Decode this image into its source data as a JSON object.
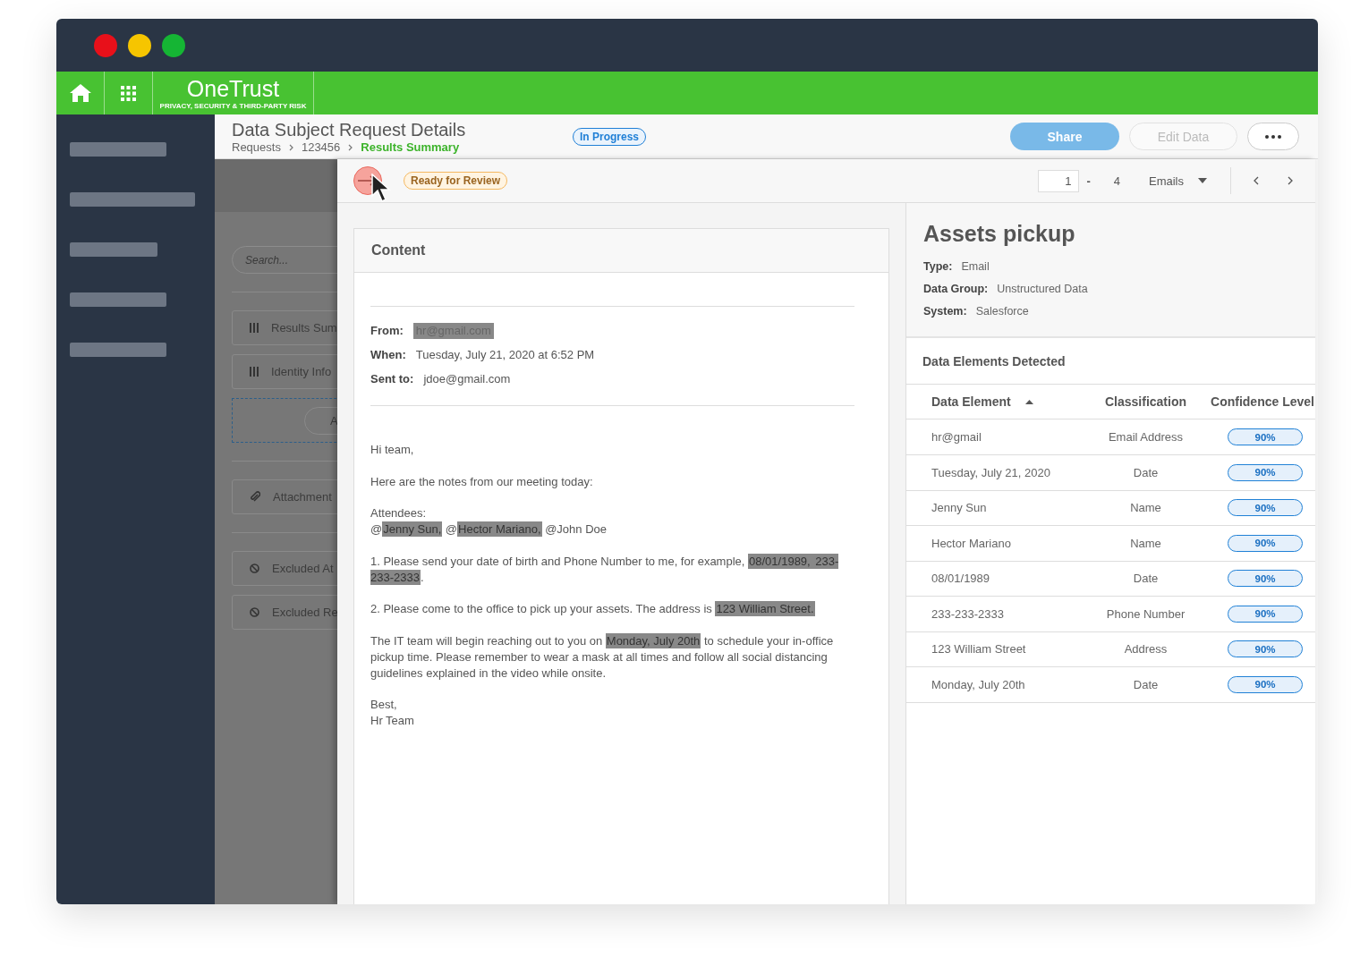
{
  "window": {
    "controls": [
      {
        "color": "#e8101a"
      },
      {
        "color": "#f6c500"
      },
      {
        "color": "#15b534"
      }
    ]
  },
  "nav": {
    "logo": "OneTrust",
    "tagline": "PRIVACY, SECURITY & THIRD-PARTY RISK"
  },
  "header": {
    "title": "Data Subject Request Details",
    "breadcrumbs": [
      {
        "label": "Requests",
        "current": false
      },
      {
        "label": "123456",
        "current": false
      },
      {
        "label": "Results Summary",
        "current": true
      }
    ],
    "status": "In Progress",
    "buttons": [
      {
        "kind": "primary",
        "label": "Share",
        "disabled": false
      },
      {
        "kind": "secondary",
        "label": "Edit Data",
        "disabled": true
      },
      {
        "kind": "more"
      }
    ]
  },
  "left_panel": {
    "search_placeholder": "Search...",
    "groups": [
      [
        {
          "kind": "list",
          "label": "Results Sum"
        },
        {
          "kind": "list",
          "label": "Identity Info"
        },
        {
          "kind": "dropzone",
          "label": "A"
        }
      ],
      [
        {
          "kind": "attachment",
          "label": "Attachment"
        }
      ],
      [
        {
          "kind": "excluded",
          "label": "Excluded At"
        },
        {
          "kind": "excluded",
          "label": "Excluded Re"
        }
      ]
    ]
  },
  "drawer": {
    "status": "Ready for Review",
    "pager": {
      "current": "1",
      "separator": "-",
      "total": "4",
      "type": "Emails"
    },
    "email": {
      "card_title": "Content",
      "fields": [
        {
          "label": "From:",
          "value": "hr@gmail.com",
          "highlighted": true
        },
        {
          "label": "When:",
          "value": "Tuesday, July 21, 2020 at 6:52 PM",
          "highlighted": false
        },
        {
          "label": "Sent to:",
          "value": "jdoe@gmail.com",
          "highlighted": false
        }
      ],
      "body": [
        {
          "lines": [
            [
              {
                "text": "Hi team,",
                "highlighted": false
              }
            ]
          ]
        },
        {
          "lines": [
            [
              {
                "text": "Here are the notes from our meeting today:",
                "highlighted": false
              }
            ]
          ]
        },
        {
          "lines": [
            [
              {
                "text": "Attendees:",
                "highlighted": false
              }
            ],
            [
              {
                "text": "@",
                "highlighted": false
              },
              {
                "text": "Jenny Sun,",
                "highlighted": true
              },
              {
                "text": " @",
                "highlighted": false
              },
              {
                "text": "Hector Mariano,",
                "highlighted": true
              },
              {
                "text": " @John Doe",
                "highlighted": false
              }
            ]
          ]
        },
        {
          "lines": [
            [
              {
                "text": "1. Please send your date of birth and Phone Number to me, for example, ",
                "highlighted": false
              },
              {
                "text": "08/01/1989, ",
                "highlighted": true
              },
              {
                "text": "233-233-2333",
                "highlighted": true
              },
              {
                "text": ".",
                "highlighted": false
              }
            ]
          ]
        },
        {
          "lines": [
            [
              {
                "text": "2. Please come to the office to pick up your assets. The address is ",
                "highlighted": false
              },
              {
                "text": "123 William Street.",
                "highlighted": true
              }
            ]
          ]
        },
        {
          "lines": [
            [
              {
                "text": "The IT team will begin reaching out to you on ",
                "highlighted": false
              },
              {
                "text": "Monday, July 20th",
                "highlighted": true
              },
              {
                "text": " to schedule your in-office pickup time. Please remember to wear a mask at all times and follow all social distancing guidelines explained in the video while onsite.",
                "highlighted": false
              }
            ]
          ]
        },
        {
          "lines": [
            [
              {
                "text": "Best,",
                "highlighted": false
              }
            ],
            [
              {
                "text": "Hr Team",
                "highlighted": false
              }
            ]
          ]
        }
      ]
    },
    "details": {
      "title": "Assets pickup",
      "properties": [
        {
          "label": "Type:",
          "value": "Email"
        },
        {
          "label": "Data Group:",
          "value": "Unstructured Data"
        },
        {
          "label": "System:",
          "value": "Salesforce"
        }
      ],
      "section_title": "Data Elements Detected",
      "columns": [
        {
          "label": "Data Element",
          "sorted": true
        },
        {
          "label": "Classification",
          "sorted": false
        },
        {
          "label": "Confidence Level",
          "sorted": false
        }
      ],
      "rows": [
        {
          "element": "hr@gmail",
          "classification": "Email Address",
          "confidence": "90%"
        },
        {
          "element": "Tuesday, July 21, 2020",
          "classification": "Date",
          "confidence": "90%"
        },
        {
          "element": "Jenny Sun",
          "classification": "Name",
          "confidence": "90%"
        },
        {
          "element": "Hector Mariano",
          "classification": "Name",
          "confidence": "90%"
        },
        {
          "element": "08/01/1989",
          "classification": "Date",
          "confidence": "90%"
        },
        {
          "element": "233-233-2333",
          "classification": "Phone Number",
          "confidence": "90%"
        },
        {
          "element": "123 William Street",
          "classification": "Address",
          "confidence": "90%"
        },
        {
          "element": "Monday, July 20th",
          "classification": "Date",
          "confidence": "90%"
        }
      ]
    }
  }
}
